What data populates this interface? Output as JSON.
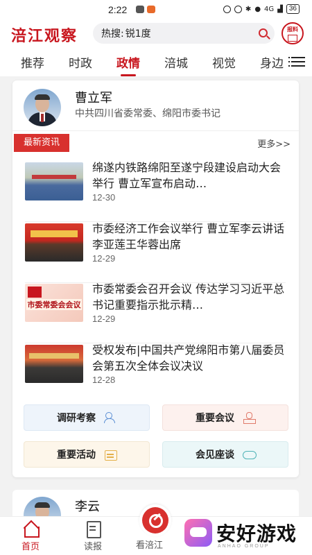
{
  "status_bar": {
    "time": "2:22",
    "battery": "36",
    "network": "4G"
  },
  "header": {
    "logo": "涪江观察",
    "search_prefix": "热搜:",
    "search_query": "锐1度",
    "baoliao": "报料"
  },
  "tabs": [
    {
      "label": "推荐"
    },
    {
      "label": "时政"
    },
    {
      "label": "政情",
      "active": true
    },
    {
      "label": "涪城"
    },
    {
      "label": "视觉"
    },
    {
      "label": "身边"
    }
  ],
  "profile": {
    "name": "曹立军",
    "title": "中共四川省委常委、绵阳市委书记"
  },
  "section": {
    "badge": "最新资讯",
    "more": "更多>>"
  },
  "news": [
    {
      "title": "绵遂内铁路绵阳至遂宁段建设启动大会举行  曹立军宣布启动…",
      "date": "12-30"
    },
    {
      "title": "市委经济工作会议举行  曹立军李云讲话  李亚莲王华蓉出席",
      "date": "12-29"
    },
    {
      "title": "市委常委会召开会议  传达学习习近平总书记重要指示批示精…",
      "date": "12-29",
      "thumb_text": "市委常委会会议"
    },
    {
      "title": "受权发布|中国共产党绵阳市第八届委员会第五次全体会议决议",
      "date": "12-28"
    }
  ],
  "categories": [
    {
      "label": "调研考察",
      "icon": "people-icon"
    },
    {
      "label": "重要会议",
      "icon": "stamp-icon"
    },
    {
      "label": "重要活动",
      "icon": "calendar-icon"
    },
    {
      "label": "会见座谈",
      "icon": "handshake-icon"
    }
  ],
  "profile2": {
    "name": "李云"
  },
  "bottom_nav": [
    {
      "label": "首页",
      "active": true
    },
    {
      "label": "读报"
    },
    {
      "label": "看涪江"
    }
  ],
  "watermark": {
    "title": "安好游戏",
    "sub": "ANHAO GROUP"
  },
  "colors": {
    "brand_red": "#c8161e",
    "badge_red": "#d8312e"
  }
}
